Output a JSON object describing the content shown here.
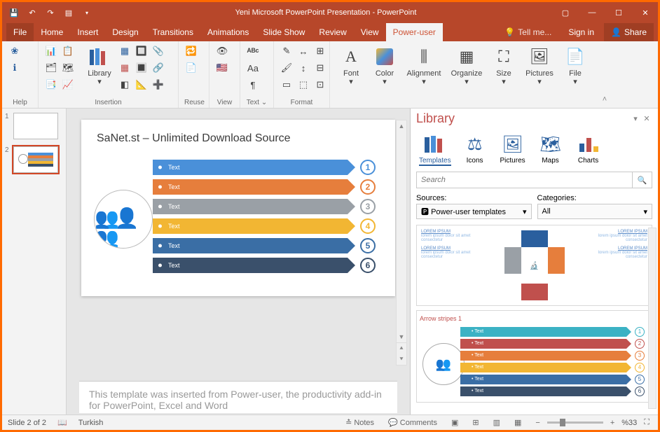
{
  "titlebar": {
    "title": "Yeni Microsoft PowerPoint Presentation - PowerPoint"
  },
  "tabs": {
    "file": "File",
    "list": [
      "Home",
      "Insert",
      "Design",
      "Transitions",
      "Animations",
      "Slide Show",
      "Review",
      "View",
      "Power-user"
    ],
    "active": "Power-user",
    "tellme": "Tell me...",
    "signin": "Sign in",
    "share": "Share"
  },
  "ribbon": {
    "groups": [
      "Help",
      "Insertion",
      "Reuse",
      "View",
      "Text",
      "Format"
    ],
    "library_btn": "Library",
    "big": {
      "font": "Font",
      "color": "Color",
      "alignment": "Alignment",
      "organize": "Organize",
      "size": "Size",
      "pictures": "Pictures",
      "file": "File"
    }
  },
  "thumbnails": [
    {
      "n": "1"
    },
    {
      "n": "2"
    }
  ],
  "slide": {
    "title": "SaNet.st – Unlimited Download Source",
    "rows": [
      {
        "label": "Text",
        "color": "#4a90d9",
        "num": "1"
      },
      {
        "label": "Text",
        "color": "#e67e3c",
        "num": "2"
      },
      {
        "label": "Text",
        "color": "#9aa0a6",
        "num": "3"
      },
      {
        "label": "Text",
        "color": "#f2b633",
        "num": "4"
      },
      {
        "label": "Text",
        "color": "#3a6ea5",
        "num": "5"
      },
      {
        "label": "Text",
        "color": "#3a506b",
        "num": "6"
      }
    ],
    "notes": "This template was inserted from Power-user, the productivity add-in for PowerPoint, Excel and Word"
  },
  "library": {
    "title": "Library",
    "cats": [
      "Templates",
      "Icons",
      "Pictures",
      "Maps",
      "Charts"
    ],
    "active_cat": "Templates",
    "search_placeholder": "Search",
    "sources_label": "Sources:",
    "categories_label": "Categories:",
    "source_sel": "Power-user templates",
    "category_sel": "All",
    "tpl1_texts": {
      "h": "LOREM IPSUM",
      "b": "lorem ipsum dolor sit amet consectetur"
    },
    "tpl2_caption": "Arrow stripes 1",
    "tpl2_rows": [
      {
        "label": "Text",
        "color": "#3bb2c4",
        "num": "1"
      },
      {
        "label": "Text",
        "color": "#c0504d",
        "num": "2"
      },
      {
        "label": "Text",
        "color": "#e67e3c",
        "num": "3"
      },
      {
        "label": "Text",
        "color": "#f2b633",
        "num": "4"
      },
      {
        "label": "Text",
        "color": "#3a6ea5",
        "num": "5"
      },
      {
        "label": "Text",
        "color": "#3a506b",
        "num": "6"
      }
    ]
  },
  "status": {
    "slide": "Slide 2 of 2",
    "lang": "Turkish",
    "notes": "Notes",
    "comments": "Comments",
    "zoom": "%33"
  }
}
